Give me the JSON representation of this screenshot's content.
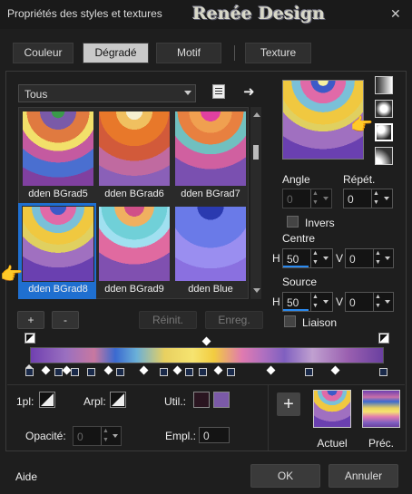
{
  "window": {
    "title": "Propriétés des styles et textures",
    "brand": "Renée Design",
    "close_glyph": "✕"
  },
  "tabs": [
    {
      "label": "Couleur",
      "active": false
    },
    {
      "label": "Dégradé",
      "active": true
    },
    {
      "label": "Motif",
      "active": false
    },
    {
      "label": "Texture",
      "active": false
    }
  ],
  "category": {
    "value": "Tous"
  },
  "gradients": [
    {
      "label": "dden BGrad5"
    },
    {
      "label": "dden BGrad6"
    },
    {
      "label": "dden BGrad7"
    },
    {
      "label": "dden BGrad8",
      "selected": true
    },
    {
      "label": "dden BGrad9"
    },
    {
      "label": "dden Blue"
    }
  ],
  "list_buttons": {
    "add": "+",
    "remove": "-",
    "reset": "Réinit.",
    "save": "Enreg."
  },
  "angle": {
    "label": "Angle",
    "value": "0"
  },
  "repeat": {
    "label": "Répét.",
    "value": "0"
  },
  "invert": {
    "label": "Invers",
    "checked": false
  },
  "center": {
    "label": "Centre",
    "h_label": "H",
    "h_value": "50",
    "v_label": "V",
    "v_value": "0"
  },
  "source": {
    "label": "Source",
    "h_label": "H",
    "h_value": "50",
    "v_label": "V",
    "v_value": "0"
  },
  "link": {
    "label": "Liaison",
    "checked": false
  },
  "stops": {
    "first_label": "1pl:",
    "back_label": "Arpl:",
    "user_label": "Util.:",
    "opacity_label": "Opacité:",
    "opacity_value": "0",
    "location_label": "Empl.:",
    "location_value": "0",
    "user_color_1": "#2a1520",
    "user_color_2": "#7b5aa8"
  },
  "previews": {
    "current": "Actuel",
    "previous": "Préc."
  },
  "footer": {
    "help": "Aide",
    "ok": "OK",
    "cancel": "Annuler"
  }
}
